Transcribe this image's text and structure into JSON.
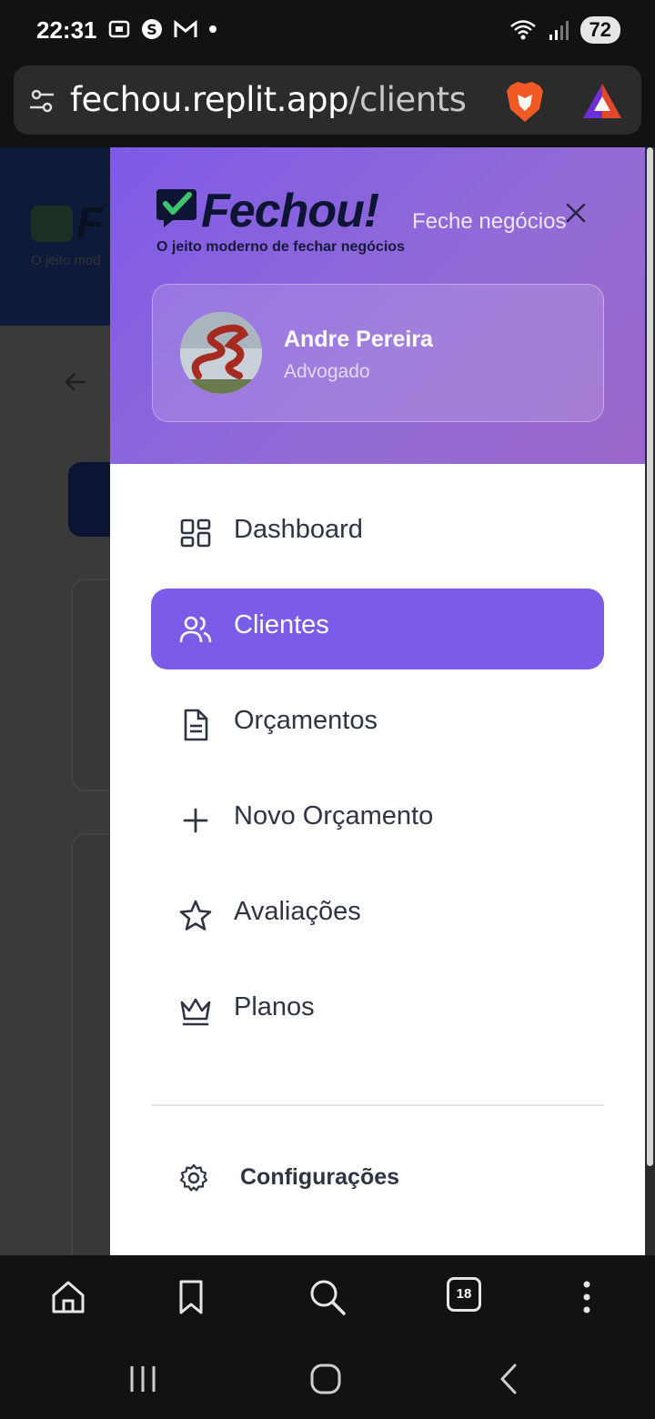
{
  "status_bar": {
    "time": "22:31",
    "left_icons": [
      "screenshot-icon",
      "shazam-icon",
      "gmail-icon",
      "dot-icon"
    ],
    "right_icons": [
      "wifi-icon",
      "signal-icon"
    ],
    "battery": "72"
  },
  "browser": {
    "url_host": "fechou.replit.app",
    "url_path": "/clients",
    "tab_count": "18",
    "toolbar_icons": [
      "home-icon",
      "bookmark-icon",
      "search-icon",
      "tabs-icon",
      "more-icon"
    ]
  },
  "background_page": {
    "logo_letter": "F",
    "logo_sub": "O jeito mod"
  },
  "drawer": {
    "brand": "Fechou!",
    "brand_sub": "O jeito moderno de fechar negócios",
    "tagline": "Feche negócios",
    "user": {
      "name": "Andre Pereira",
      "role": "Advogado"
    },
    "nav": [
      {
        "label": "Dashboard",
        "icon": "dashboard-icon",
        "active": false
      },
      {
        "label": "Clientes",
        "icon": "users-icon",
        "active": true
      },
      {
        "label": "Orçamentos",
        "icon": "document-icon",
        "active": false
      },
      {
        "label": "Novo Orçamento",
        "icon": "plus-icon",
        "active": false
      },
      {
        "label": "Avaliações",
        "icon": "star-icon",
        "active": false
      },
      {
        "label": "Planos",
        "icon": "crown-icon",
        "active": false
      }
    ],
    "settings_label": "Configurações"
  },
  "colors": {
    "accent": "#7b5ce8",
    "header_gradient_start": "#7e5ae6",
    "header_gradient_end": "#9a67c9",
    "brand_check": "#3ec46d",
    "text_dark": "#2f3443"
  }
}
